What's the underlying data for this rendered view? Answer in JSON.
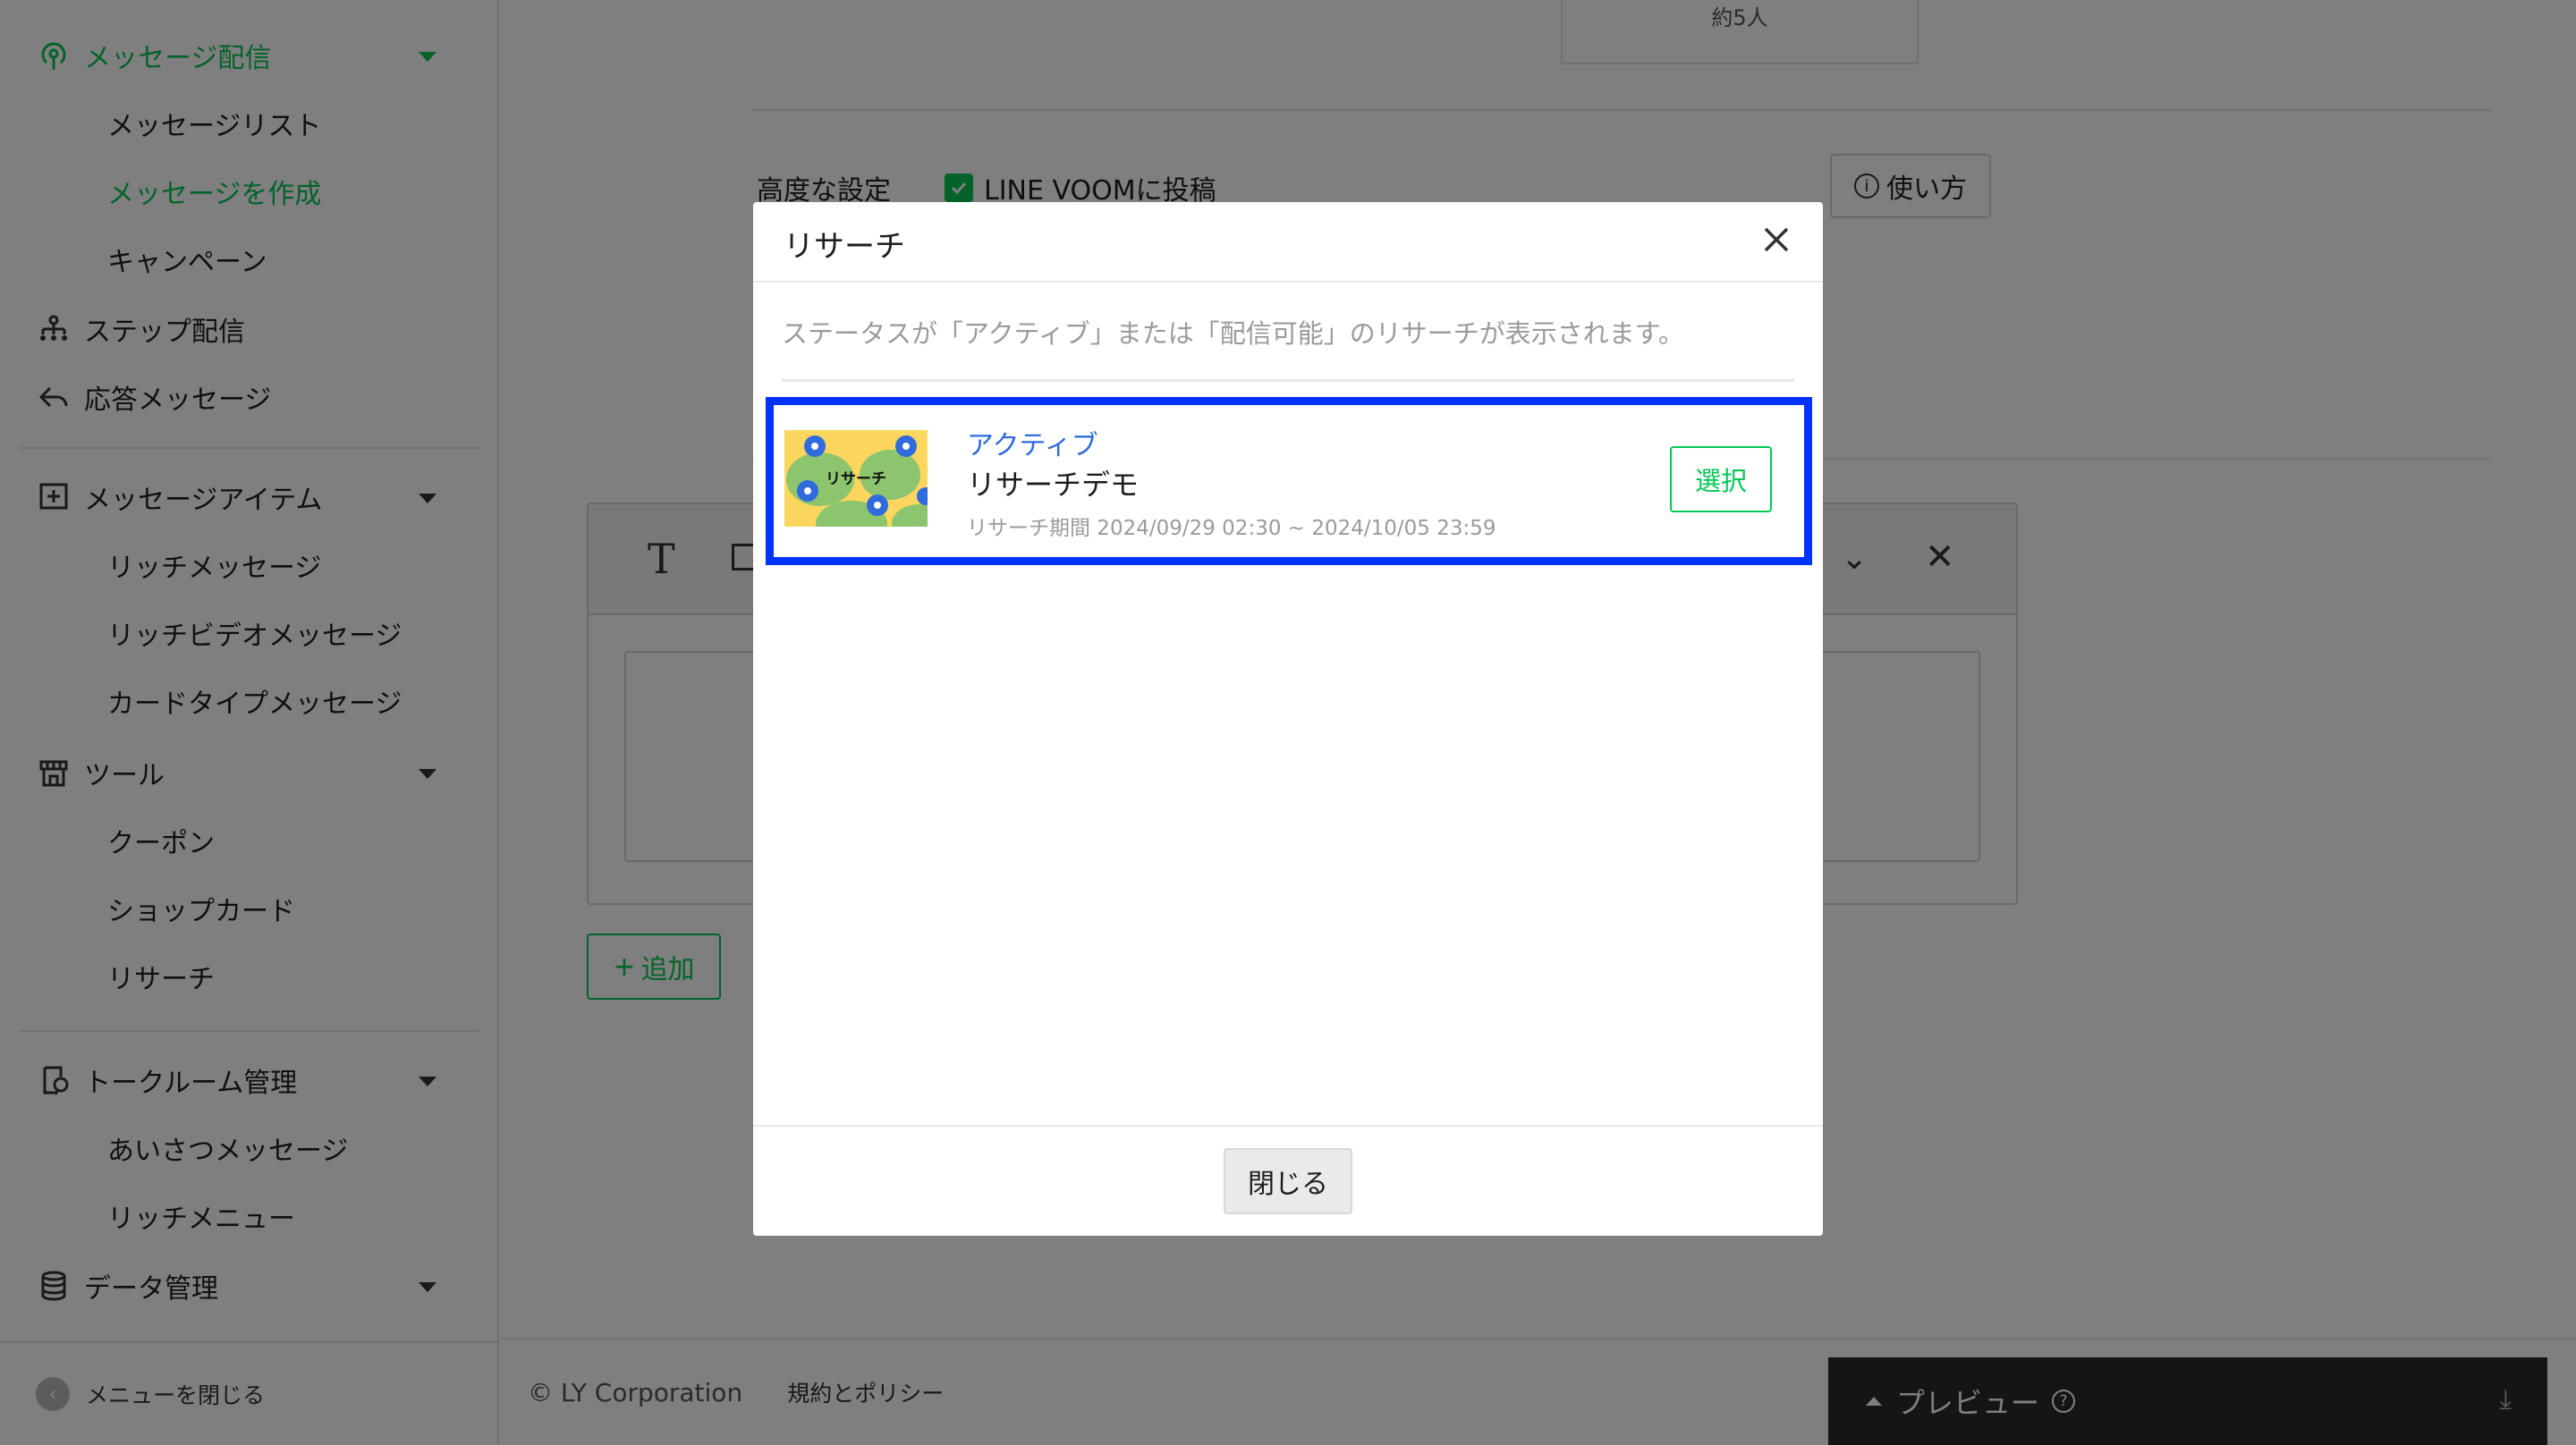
{
  "sidebar": {
    "groups": [
      {
        "label": "メッセージ配信",
        "icon": "broadcast-icon",
        "expanded": true,
        "active": true,
        "items": [
          {
            "label": "メッセージリスト",
            "active": false
          },
          {
            "label": "メッセージを作成",
            "active": true
          },
          {
            "label": "キャンペーン",
            "active": false
          }
        ]
      },
      {
        "label": "ステップ配信",
        "icon": "step-tree-icon"
      },
      {
        "label": "応答メッセージ",
        "icon": "reply-icon"
      },
      {
        "label": "メッセージアイテム",
        "icon": "add-box-icon",
        "expanded": true,
        "items": [
          {
            "label": "リッチメッセージ"
          },
          {
            "label": "リッチビデオメッセージ"
          },
          {
            "label": "カードタイプメッセージ"
          }
        ]
      },
      {
        "label": "ツール",
        "icon": "shop-icon",
        "expanded": true,
        "items": [
          {
            "label": "クーポン"
          },
          {
            "label": "ショップカード"
          },
          {
            "label": "リサーチ"
          }
        ]
      },
      {
        "label": "トークルーム管理",
        "icon": "chatroom-icon",
        "expanded": true,
        "items": [
          {
            "label": "あいさつメッセージ"
          },
          {
            "label": "リッチメニュー"
          }
        ]
      },
      {
        "label": "データ管理",
        "icon": "database-icon",
        "expanded": false
      }
    ],
    "collapse_label": "メニューを閉じる",
    "accent": "#06c755"
  },
  "main": {
    "reach_text": "約5人",
    "advanced_label": "高度な設定",
    "voom_label": "LINE VOOMに投稿",
    "voom_checked": true,
    "howto_label": "使い方",
    "add_label": "追加"
  },
  "footer": {
    "copyright": "© LY Corporation",
    "policy": "規約とポリシー"
  },
  "preview": {
    "label": "プレビュー"
  },
  "modal": {
    "title": "リサーチ",
    "description": "ステータスが「アクティブ」または「配信可能」のリサーチが表示されます。",
    "items": [
      {
        "status": "アクティブ",
        "name": "リサーチデモ",
        "period": "リサーチ期間 2024/09/29 02:30 ~ 2024/10/05 23:59",
        "thumb_text": "リサーチ",
        "select_label": "選択"
      }
    ],
    "close_label": "閉じる",
    "highlight_color": "#0033ff"
  }
}
